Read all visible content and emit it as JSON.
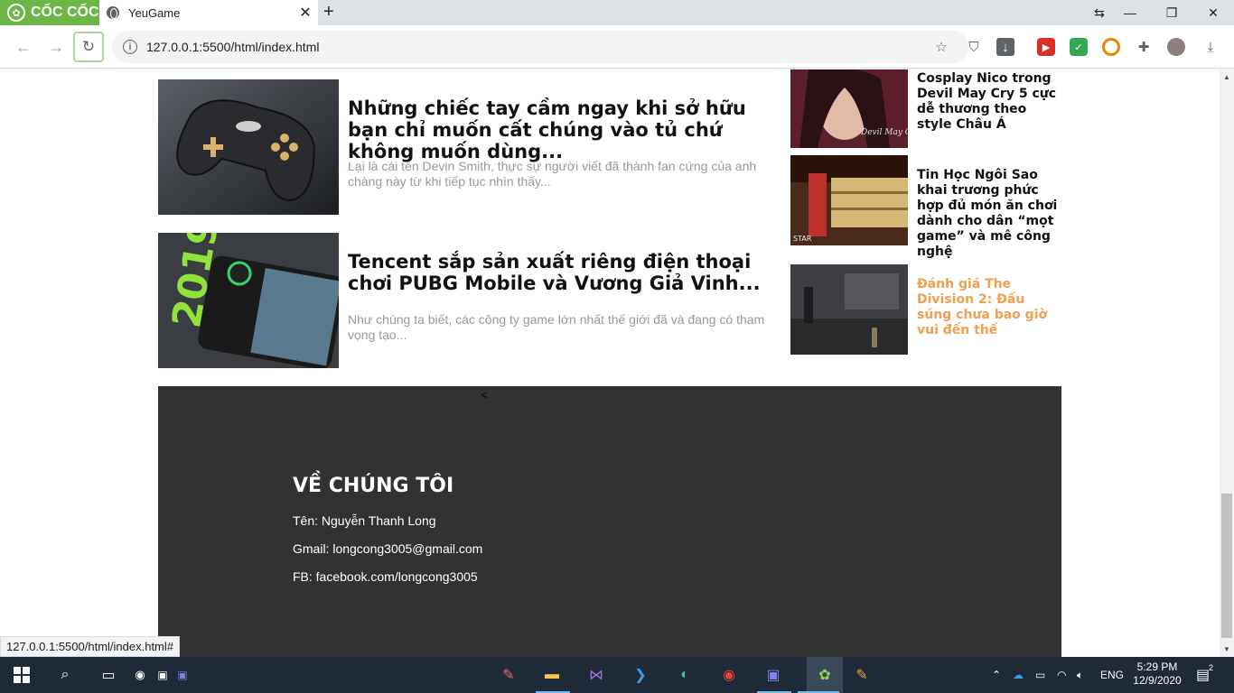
{
  "browser": {
    "brand": "CỐC CỐC",
    "tab_title": "YeuGame",
    "url": "127.0.0.1:5500/html/index.html",
    "status_url": "127.0.0.1:5500/html/index.html#"
  },
  "articles": [
    {
      "title": "Những chiếc tay cầm ngay khi sở hữu bạn chỉ muốn cất chúng vào tủ chứ không muốn dùng...",
      "excerpt": "Lại là cái tên Devin Smith, thực sự người viết đã thành fan cứng của anh chàng này từ khi tiếp tục nhìn thấy..."
    },
    {
      "title": "Tencent sắp sản xuất riêng điện thoại chơi PUBG Mobile và Vương Giả Vinh...",
      "excerpt": "Như chúng ta biết, các công ty game lớn nhất thế giới đã và đang có tham vọng tạo...",
      "thumb_text": "2019"
    }
  ],
  "sidebar": [
    {
      "title": "Cosplay Nico trong Devil May Cry 5 cực dễ thương theo style Châu Á",
      "thumb_text": "Devil May Cry"
    },
    {
      "title": "Tin Học Ngôi Sao khai trương phức hợp đủ món ăn chơi dành cho dân “mọt game” và mê công nghệ",
      "thumb_text": "STAR"
    },
    {
      "title": "Đánh giá The Division 2: Đấu súng chưa bao giờ vui đến thế"
    }
  ],
  "footer": {
    "stray": "<",
    "heading": "VỀ CHÚNG TÔI",
    "name_line": "Tên: Nguyễn Thanh Long",
    "email_line": "Gmail: longcong3005@gmail.com",
    "fb_line": "FB: facebook.com/longcong3005"
  },
  "taskbar": {
    "time": "5:29 PM",
    "date": "12/9/2020",
    "lang": "ENG",
    "notif_count": "2"
  },
  "colors": {
    "brand_green": "#6bb646",
    "footer_bg": "#323232",
    "accent_orange": "#f0a050",
    "excerpt_gray": "#999999"
  }
}
